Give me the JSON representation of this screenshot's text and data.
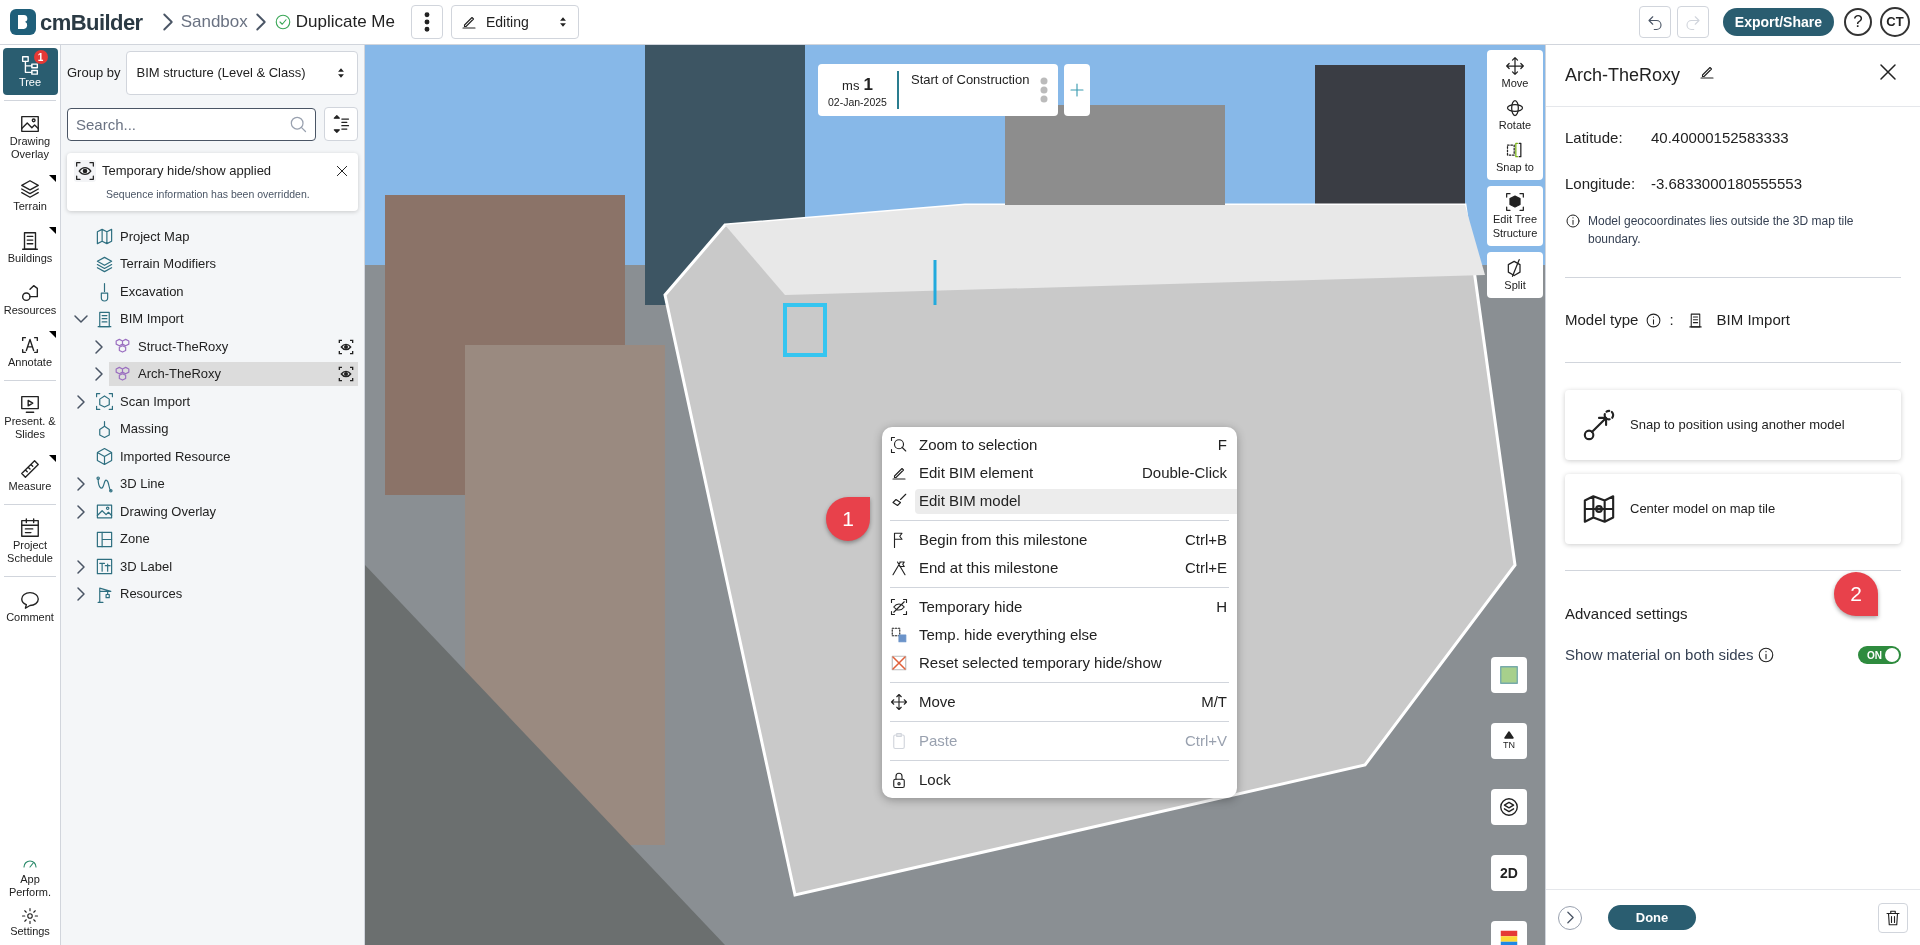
{
  "top_bar": {
    "logo": "cmBuilder",
    "breadcrumbs": [
      "Sandbox",
      "Duplicate Me"
    ],
    "mode": "Editing",
    "export": "Export/Share",
    "help": "?",
    "user": "CT"
  },
  "rail": {
    "items": [
      {
        "label": "Tree",
        "selected": true,
        "badge": "1",
        "flyout": false
      },
      {
        "label": "Drawing Overlay",
        "selected": false,
        "flyout": false
      },
      {
        "label": "Terrain",
        "selected": false,
        "flyout": true
      },
      {
        "label": "Buildings",
        "selected": false,
        "flyout": true
      },
      {
        "label": "Resources",
        "selected": false,
        "flyout": false
      },
      {
        "label": "Annotate",
        "selected": false,
        "flyout": true
      },
      {
        "label": "Present. & Slides",
        "selected": false,
        "flyout": false
      },
      {
        "label": "Measure",
        "selected": false,
        "flyout": true
      },
      {
        "label": "Project Schedule",
        "selected": false,
        "flyout": false
      },
      {
        "label": "Comment",
        "selected": false,
        "flyout": false
      }
    ],
    "bottom": [
      "App Perform.",
      "Settings"
    ]
  },
  "tree_panel": {
    "group_by_label": "Group by",
    "group_by_value": "BIM structure (Level & Class)",
    "search": {
      "placeholder": "Search..."
    },
    "notice": {
      "title": "Temporary hide/show applied",
      "body": "Sequence information has been overridden."
    },
    "items": [
      {
        "label": "Project Map"
      },
      {
        "label": "Terrain Modifiers"
      },
      {
        "label": "Excavation"
      },
      {
        "label": "BIM Import",
        "expanded": true,
        "children": [
          {
            "label": "Struct-TheRoxy",
            "expanded": false,
            "selected": false,
            "temp_hidden": true
          },
          {
            "label": "Arch-TheRoxy",
            "expanded": false,
            "selected": true,
            "temp_hidden": true
          }
        ]
      },
      {
        "label": "Scan Import",
        "expanded": false
      },
      {
        "label": "Massing"
      },
      {
        "label": "Imported Resource"
      },
      {
        "label": "3D Line",
        "expanded": false
      },
      {
        "label": "Drawing Overlay",
        "expanded": false
      },
      {
        "label": "Zone"
      },
      {
        "label": "3D Label",
        "expanded": false
      },
      {
        "label": "Resources",
        "expanded": false
      }
    ]
  },
  "viewport": {
    "milestone": {
      "prefix": "ms",
      "number": "1",
      "date": "02-Jan-2025",
      "name": "Start of Construction"
    },
    "tools": [
      "Move",
      "Rotate",
      "Snap to",
      "Edit Tree Structure",
      "Split"
    ],
    "north_label": "TN",
    "view_button": "2D",
    "context_menu": [
      {
        "items": [
          {
            "label": "Zoom to selection",
            "shortcut": "F",
            "selected": false,
            "disabled": false
          },
          {
            "label": "Edit BIM element",
            "shortcut": "Double-Click",
            "selected": false,
            "disabled": false
          },
          {
            "label": "Edit BIM model",
            "selected": true,
            "disabled": false
          }
        ]
      },
      {
        "items": [
          {
            "label": "Begin from this milestone",
            "shortcut": "Ctrl+B",
            "selected": false,
            "disabled": false
          },
          {
            "label": "End at this milestone",
            "shortcut": "Ctrl+E",
            "selected": false,
            "disabled": false
          }
        ]
      },
      {
        "items": [
          {
            "label": "Temporary hide",
            "shortcut": "H",
            "selected": false,
            "disabled": false
          },
          {
            "label": "Temp. hide everything else",
            "selected": false,
            "disabled": false
          },
          {
            "label": "Reset selected temporary hide/show",
            "selected": false,
            "disabled": false
          }
        ]
      },
      {
        "items": [
          {
            "label": "Move",
            "shortcut": "M/T",
            "selected": false,
            "disabled": false
          }
        ]
      },
      {
        "items": [
          {
            "label": "Paste",
            "shortcut": "Ctrl+V",
            "selected": false,
            "disabled": true
          }
        ]
      },
      {
        "items": [
          {
            "label": "Lock",
            "selected": false,
            "disabled": false
          }
        ]
      }
    ],
    "callouts": [
      "1",
      "2"
    ]
  },
  "properties": {
    "title": "Arch-TheRoxy",
    "coordinates": [
      {
        "label": "Latitude:",
        "value": "40.40000152583333"
      },
      {
        "label": "Longitude:",
        "value": "-3.6833000180555553"
      }
    ],
    "note": "Model geocoordinates lies outside the 3D map tile boundary.",
    "model_type_label": "Model type",
    "model_type_separator": ":",
    "model_type_value": "BIM Import",
    "actions": [
      "Snap to position using another model",
      "Center model on map tile"
    ],
    "advanced_heading": "Advanced settings",
    "toggle": {
      "label": "Show material on both sides",
      "on": true,
      "text": "ON"
    },
    "done": "Done"
  }
}
